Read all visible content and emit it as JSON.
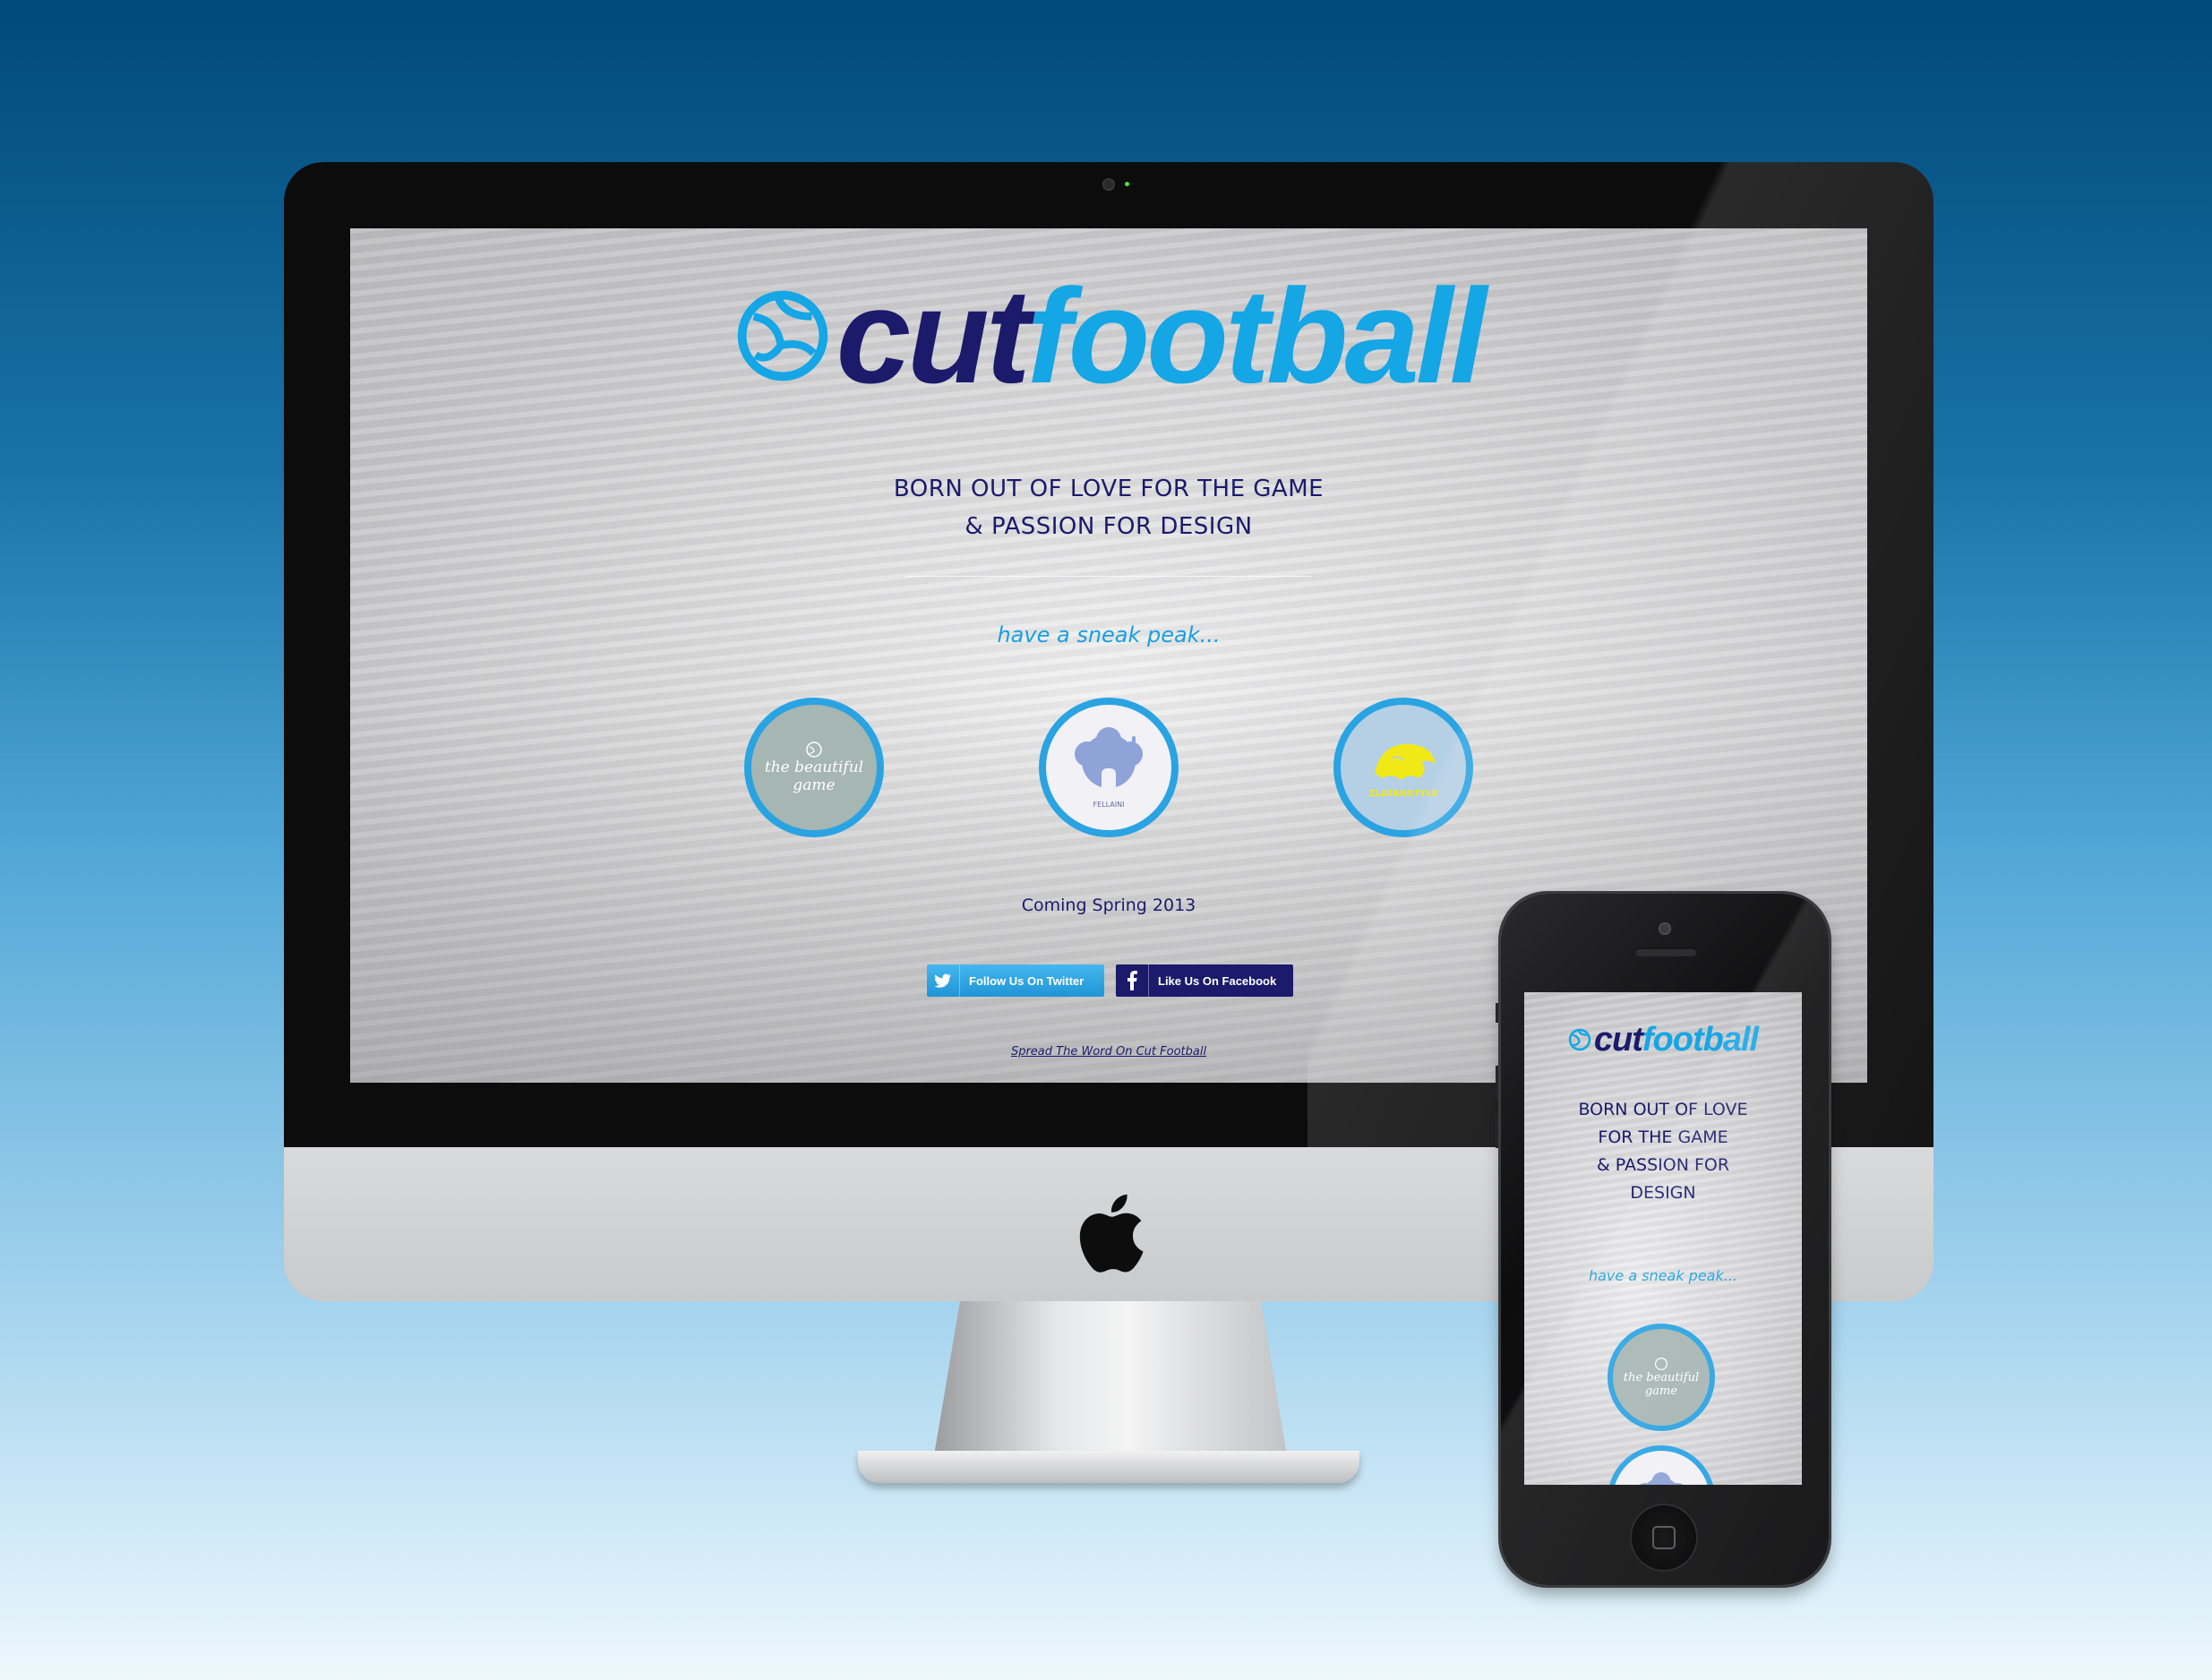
{
  "brand": {
    "cut": "cut",
    "football": "football"
  },
  "desktop": {
    "tagline_line1": "BORN OUT OF LOVE FOR THE GAME",
    "tagline_line2": "& PASSION FOR DESIGN",
    "sneak": "have a sneak peak...",
    "products": [
      {
        "name": "the beautiful game"
      },
      {
        "name": "FELLAINI"
      },
      {
        "name": "ZLATANSTYLE"
      }
    ],
    "coming": "Coming Spring 2013",
    "twitter_label": "Follow Us On Twitter",
    "facebook_label": "Like Us On Facebook",
    "spread": "Spread The Word On Cut Football"
  },
  "phone": {
    "tagline_lines": [
      "BORN OUT OF LOVE",
      "FOR THE GAME",
      "& PASSION FOR",
      "DESIGN"
    ],
    "sneak": "have a sneak peak...",
    "product": "the beautiful game"
  },
  "colors": {
    "navy": "#1b1a6b",
    "sky": "#15a6e6",
    "ring": "#2aa3e2",
    "zlatan_yellow": "#f1e916"
  },
  "icons": [
    "football-icon",
    "twitter-bird-icon",
    "facebook-f-icon",
    "apple-logo-icon",
    "home-button-icon"
  ]
}
